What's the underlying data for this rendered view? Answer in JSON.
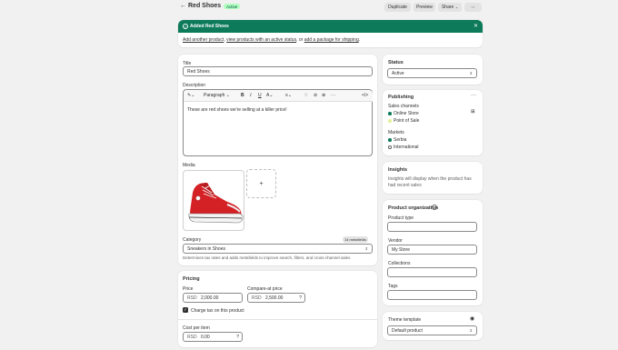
{
  "header": {
    "title": "Red Shoes",
    "status_badge": "Active",
    "duplicate": "Duplicate",
    "preview": "Preview",
    "share": "Share"
  },
  "banner": {
    "title": "Added Red Shoes",
    "link1": "Add another product",
    "sep1": ", ",
    "link2": "view products with an active status",
    "sep2": ", or ",
    "link3": "add a package for shipping",
    "end": "."
  },
  "product": {
    "title_label": "Title",
    "title_value": "Red Shoes",
    "description_label": "Description",
    "paragraph": "Paragraph",
    "description_text": "These are red shoes we're selling at a killer price!",
    "media_label": "Media",
    "add_media": "+",
    "category_label": "Category",
    "metafields_badge": "14 metafields",
    "category_value": "Sneakers in Shoes",
    "category_help": "Determines tax rates and adds metafields to improve search, filters, and cross-channel sales"
  },
  "pricing": {
    "title": "Pricing",
    "price_label": "Price",
    "price_currency": "RSD",
    "price_value": "2,000.00",
    "compare_label": "Compare-at price",
    "compare_currency": "RSD",
    "compare_value": "2,500.00",
    "charge_tax": "Charge tax on this product",
    "cost_label": "Cost per item",
    "cost_currency": "RSD",
    "cost_value": "0.00"
  },
  "status": {
    "title": "Status",
    "value": "Active"
  },
  "publishing": {
    "title": "Publishing",
    "sales_channels_label": "Sales channels",
    "channels": [
      "Online Store",
      "Point of Sale"
    ],
    "markets_label": "Markets",
    "markets": [
      "Serbia",
      "International"
    ]
  },
  "insights": {
    "title": "Insights",
    "text": "Insights will display when the product has had recent sales"
  },
  "organization": {
    "title": "Product organization",
    "product_type_label": "Product type",
    "product_type_value": "",
    "vendor_label": "Vendor",
    "vendor_value": "My Store",
    "collections_label": "Collections",
    "collections_value": "",
    "tags_label": "Tags",
    "tags_value": ""
  },
  "theme": {
    "title": "Theme template",
    "value": "Default product"
  },
  "colors": {
    "banner_green": "#0d7a5a",
    "badge_green_bg": "#affebf",
    "badge_green_text": "#014b40",
    "page_bg": "#f1f1f1",
    "shoe_red": "#d42126"
  }
}
